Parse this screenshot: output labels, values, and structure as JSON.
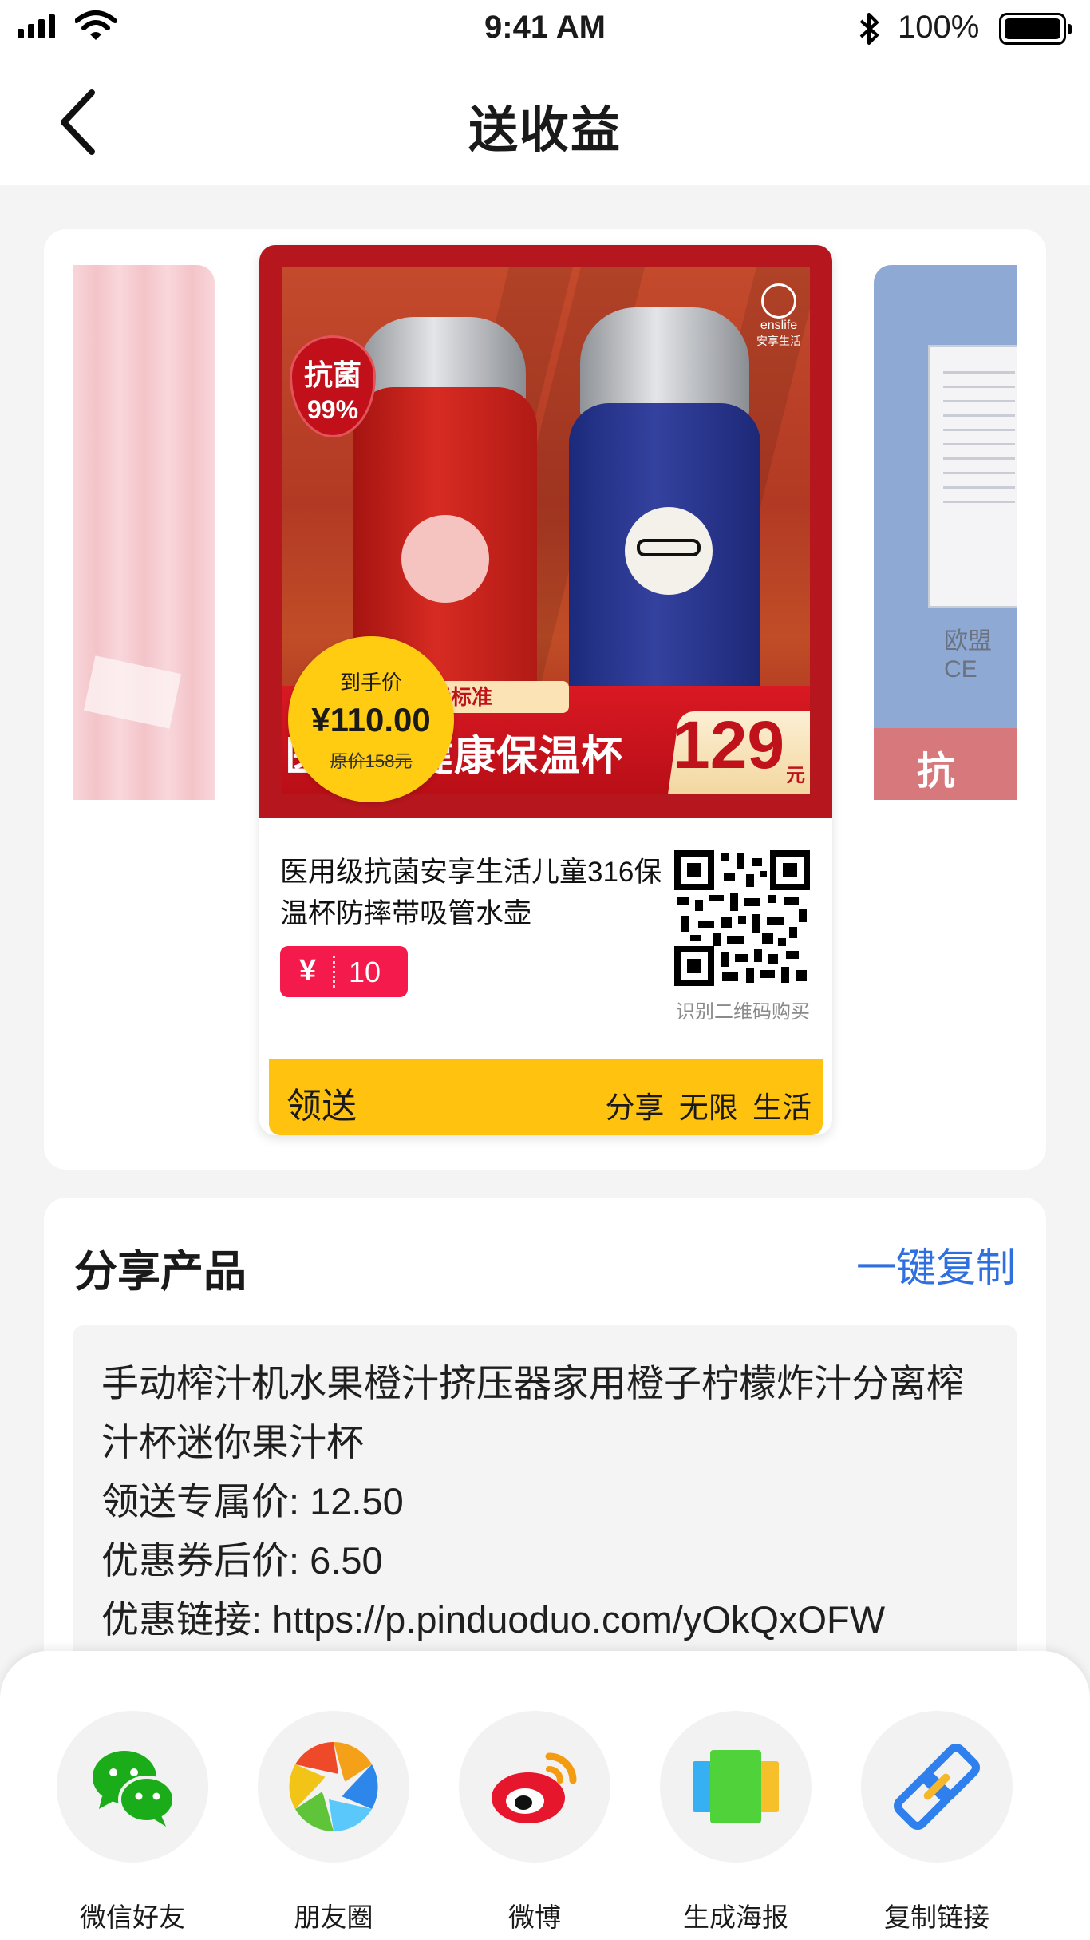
{
  "status_bar": {
    "time": "9:41 AM",
    "battery": "100%"
  },
  "nav": {
    "title": "送收益"
  },
  "carousel": {
    "right_side": {
      "doc_label": "欧盟CE",
      "band_text": "抗 菌"
    },
    "poster": {
      "brand_name": "enslife",
      "brand_cn": "安享生活",
      "badge_line1": "抗菌",
      "badge_line2": "99%",
      "standard_tag": "国际标准",
      "headline": "医用级健康保温杯",
      "corner_price": "129",
      "corner_unit": "元",
      "final_price_label": "到手价",
      "final_price": "¥110.00",
      "original_price": "原价158元",
      "product_title": "医用级抗菌安享生活儿童316保温杯防摔带吸管水壶",
      "coupon_symbol": "¥",
      "coupon_amount": "10",
      "qr_caption": "识别二维码购买",
      "footer_brand": "领送",
      "footer_slogan": "分享 无限 生活"
    }
  },
  "share_section": {
    "title": "分享产品",
    "copy_label": "一键复制",
    "lines": [
      "手动榨汁机水果橙汁挤压器家用橙子柠檬炸汁分离榨汁杯迷你果汁杯",
      "领送专属价: 12.50",
      "优惠券后价: 6.50",
      "优惠链接: https://p.pinduoduo.com/yOkQxOFW"
    ]
  },
  "share_sheet": {
    "options": [
      {
        "label": "微信好友",
        "icon": "wechat-icon"
      },
      {
        "label": "朋友圈",
        "icon": "moments-icon"
      },
      {
        "label": "微博",
        "icon": "weibo-icon"
      },
      {
        "label": "生成海报",
        "icon": "poster-icon"
      },
      {
        "label": "复制链接",
        "icon": "link-icon"
      }
    ]
  }
}
